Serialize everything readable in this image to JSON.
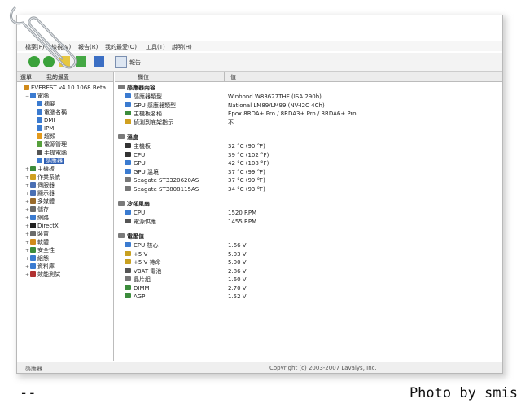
{
  "menu": [
    "檔案(F)",
    "檢視(V)",
    "報告(R)",
    "我的最愛(O)",
    "工具(T)",
    "說明(H)"
  ],
  "toolbar": {
    "report_label": "報告"
  },
  "left_tabs": [
    "選單",
    "我的最愛"
  ],
  "tree": [
    {
      "label": "EVEREST v4.10.1068 Beta",
      "level": 0,
      "color": "#d08a1a",
      "exp": ""
    },
    {
      "label": "電腦",
      "level": 1,
      "color": "#3b7bd0",
      "exp": "−"
    },
    {
      "label": "摘要",
      "level": 2,
      "color": "#3b7bd0",
      "exp": ""
    },
    {
      "label": "電腦名稱",
      "level": 2,
      "color": "#3b7bd0",
      "exp": ""
    },
    {
      "label": "DMI",
      "level": 2,
      "color": "#3b7bd0",
      "exp": ""
    },
    {
      "label": "IPMI",
      "level": 2,
      "color": "#3b7bd0",
      "exp": ""
    },
    {
      "label": "超頻",
      "level": 2,
      "color": "#e39a1c",
      "exp": ""
    },
    {
      "label": "電源管理",
      "level": 2,
      "color": "#56a03c",
      "exp": ""
    },
    {
      "label": "手提電腦",
      "level": 2,
      "color": "#555555",
      "exp": ""
    },
    {
      "label": "感應器",
      "level": 2,
      "color": "#3b7bd0",
      "exp": "",
      "selected": true
    },
    {
      "label": "主機板",
      "level": 1,
      "color": "#3c8c3c",
      "exp": "+"
    },
    {
      "label": "作業系統",
      "level": 1,
      "color": "#d0a020",
      "exp": "+"
    },
    {
      "label": "伺服器",
      "level": 1,
      "color": "#4a6fb3",
      "exp": "+"
    },
    {
      "label": "顯示器",
      "level": 1,
      "color": "#4a6fb3",
      "exp": "+"
    },
    {
      "label": "多媒體",
      "level": 1,
      "color": "#9a6a2a",
      "exp": "+"
    },
    {
      "label": "儲存",
      "level": 1,
      "color": "#6a6a6a",
      "exp": "+"
    },
    {
      "label": "網路",
      "level": 1,
      "color": "#3b7bd0",
      "exp": "+"
    },
    {
      "label": "DirectX",
      "level": 1,
      "color": "#222222",
      "exp": "+"
    },
    {
      "label": "裝置",
      "level": 1,
      "color": "#6a6a6a",
      "exp": "+"
    },
    {
      "label": "軟體",
      "level": 1,
      "color": "#d08a1a",
      "exp": "+"
    },
    {
      "label": "安全性",
      "level": 1,
      "color": "#3c8c3c",
      "exp": "+"
    },
    {
      "label": "組態",
      "level": 1,
      "color": "#3b7bd0",
      "exp": "+"
    },
    {
      "label": "資料庫",
      "level": 1,
      "color": "#3b7bd0",
      "exp": "+"
    },
    {
      "label": "效能測試",
      "level": 1,
      "color": "#b03030",
      "exp": "+"
    }
  ],
  "columns": {
    "field": "欄位",
    "value": "值"
  },
  "sections": [
    {
      "title": "感應器內容",
      "rows": [
        {
          "field": "感應器類型",
          "value": "Winbond W83627THF  (ISA 290h)",
          "color": "#3b7bd0"
        },
        {
          "field": "GPU 感應器類型",
          "value": "National LM89/LM99  (NV-I2C 4Ch)",
          "color": "#3b7bd0"
        },
        {
          "field": "主機板名稱",
          "value": "Epox 8RDA+ Pro / 8RDA3+ Pro / 8RDA6+ Pro",
          "color": "#3c8c3c"
        },
        {
          "field": "偵測到底架指示",
          "value": "不",
          "color": "#d0a020"
        }
      ]
    },
    {
      "title": "溫度",
      "rows": [
        {
          "field": "主機板",
          "value": "32 °C  (90 °F)",
          "color": "#333333"
        },
        {
          "field": "CPU",
          "value": "39 °C  (102 °F)",
          "color": "#333333"
        },
        {
          "field": "GPU",
          "value": "42 °C  (108 °F)",
          "color": "#3b7bd0"
        },
        {
          "field": "GPU 溫境",
          "value": "37 °C  (99 °F)",
          "color": "#3b7bd0"
        },
        {
          "field": "Seagate ST3320620AS",
          "value": "37 °C  (99 °F)",
          "color": "#777777"
        },
        {
          "field": "Seagate ST3808115AS",
          "value": "34 °C  (93 °F)",
          "color": "#777777"
        }
      ]
    },
    {
      "title": "冷卻風扇",
      "rows": [
        {
          "field": "CPU",
          "value": "1520 RPM",
          "color": "#3b7bd0"
        },
        {
          "field": "電源供應",
          "value": "1455 RPM",
          "color": "#555555"
        }
      ]
    },
    {
      "title": "電壓值",
      "rows": [
        {
          "field": "CPU 核心",
          "value": "1.66 V",
          "color": "#3b7bd0"
        },
        {
          "field": "+5 V",
          "value": "5.03 V",
          "color": "#c8a020"
        },
        {
          "field": "+5 V 待命",
          "value": "5.00 V",
          "color": "#c8a020"
        },
        {
          "field": "VBAT 電池",
          "value": "2.86 V",
          "color": "#555555"
        },
        {
          "field": "晶片組",
          "value": "1.60 V",
          "color": "#777777"
        },
        {
          "field": "DIMM",
          "value": "2.70 V",
          "color": "#3c8c3c"
        },
        {
          "field": "AGP",
          "value": "1.52 V",
          "color": "#3c8c3c"
        }
      ]
    }
  ],
  "status": {
    "left": "感應器",
    "right": "Copyright (c) 2003-2007 Lavalys, Inc."
  },
  "caption": {
    "dash": "--",
    "credit": "Photo by smis"
  }
}
